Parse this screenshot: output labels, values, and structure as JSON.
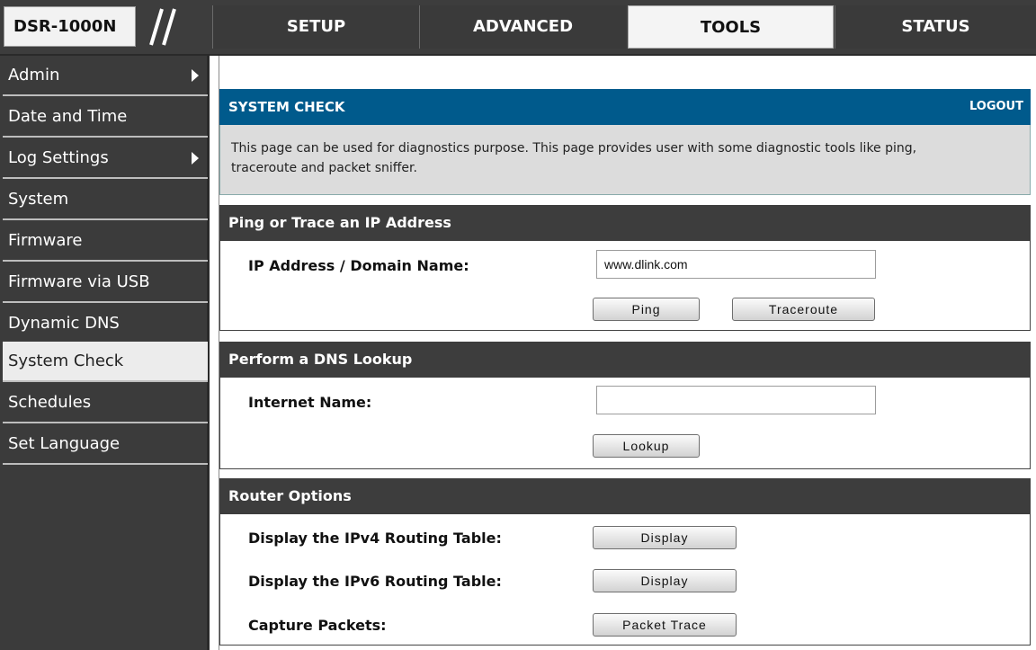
{
  "header": {
    "model": "DSR-1000N",
    "tabs": [
      {
        "label": "SETUP"
      },
      {
        "label": "ADVANCED"
      },
      {
        "label": "TOOLS"
      },
      {
        "label": "STATUS"
      }
    ],
    "active_tab": "TOOLS"
  },
  "sidebar": {
    "items": [
      {
        "label": "Admin"
      },
      {
        "label": "Date and Time"
      },
      {
        "label": "Log Settings"
      },
      {
        "label": "System"
      },
      {
        "label": "Firmware"
      },
      {
        "label": "Firmware via USB"
      },
      {
        "label": "Dynamic DNS"
      },
      {
        "label": "System Check"
      },
      {
        "label": "Schedules"
      },
      {
        "label": "Set Language"
      }
    ],
    "active": "System Check"
  },
  "page": {
    "title": "SYSTEM CHECK",
    "logout_label": "LOGOUT",
    "description_line1": "This page can be used for diagnostics purpose. This page provides user with some diagnostic tools like ping,",
    "description_line2": "traceroute and packet sniffer."
  },
  "ping_section": {
    "title": "Ping or Trace an IP Address",
    "ip_label": "IP Address / Domain Name:",
    "ip_value": "www.dlink.com",
    "ping_label": "Ping",
    "traceroute_label": "Traceroute"
  },
  "dns_section": {
    "title": "Perform a DNS Lookup",
    "name_label": "Internet Name:",
    "name_value": "",
    "lookup_label": "Lookup"
  },
  "router_section": {
    "title": "Router Options",
    "ipv4_label": "Display the IPv4 Routing Table:",
    "ipv4_button": "Display",
    "ipv6_label": "Display the IPv6 Routing Table:",
    "ipv6_button": "Display",
    "capture_label": "Capture Packets:",
    "capture_button": "Packet Trace"
  },
  "colors": {
    "header_bar": "#3d3d3d",
    "title_blue": "#005a8c",
    "description_bg": "#dcdcdc"
  }
}
